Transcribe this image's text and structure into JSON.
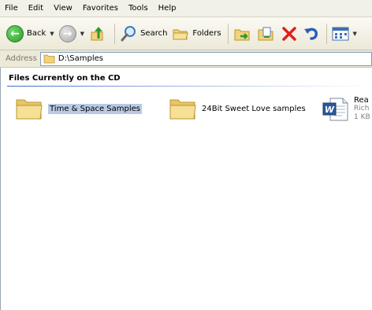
{
  "menu": [
    "File",
    "Edit",
    "View",
    "Favorites",
    "Tools",
    "Help"
  ],
  "toolbar": {
    "back_label": "Back",
    "search_label": "Search",
    "folders_label": "Folders"
  },
  "address": {
    "label": "Address",
    "value": "D:\\Samples"
  },
  "content": {
    "group_title": "Files Currently on the CD",
    "items": [
      {
        "name": "Time & Space Samples",
        "type": "folder",
        "selected": true
      },
      {
        "name": "24Bit Sweet Love samples",
        "type": "folder",
        "selected": false
      },
      {
        "name": "Rea",
        "type": "word-document",
        "sub1": "Rich",
        "sub2": "1 KB"
      }
    ]
  },
  "colors": {
    "selection": "#b9c9e5",
    "accent_line": "#3b6bc9",
    "folder": "#f2d27c"
  }
}
